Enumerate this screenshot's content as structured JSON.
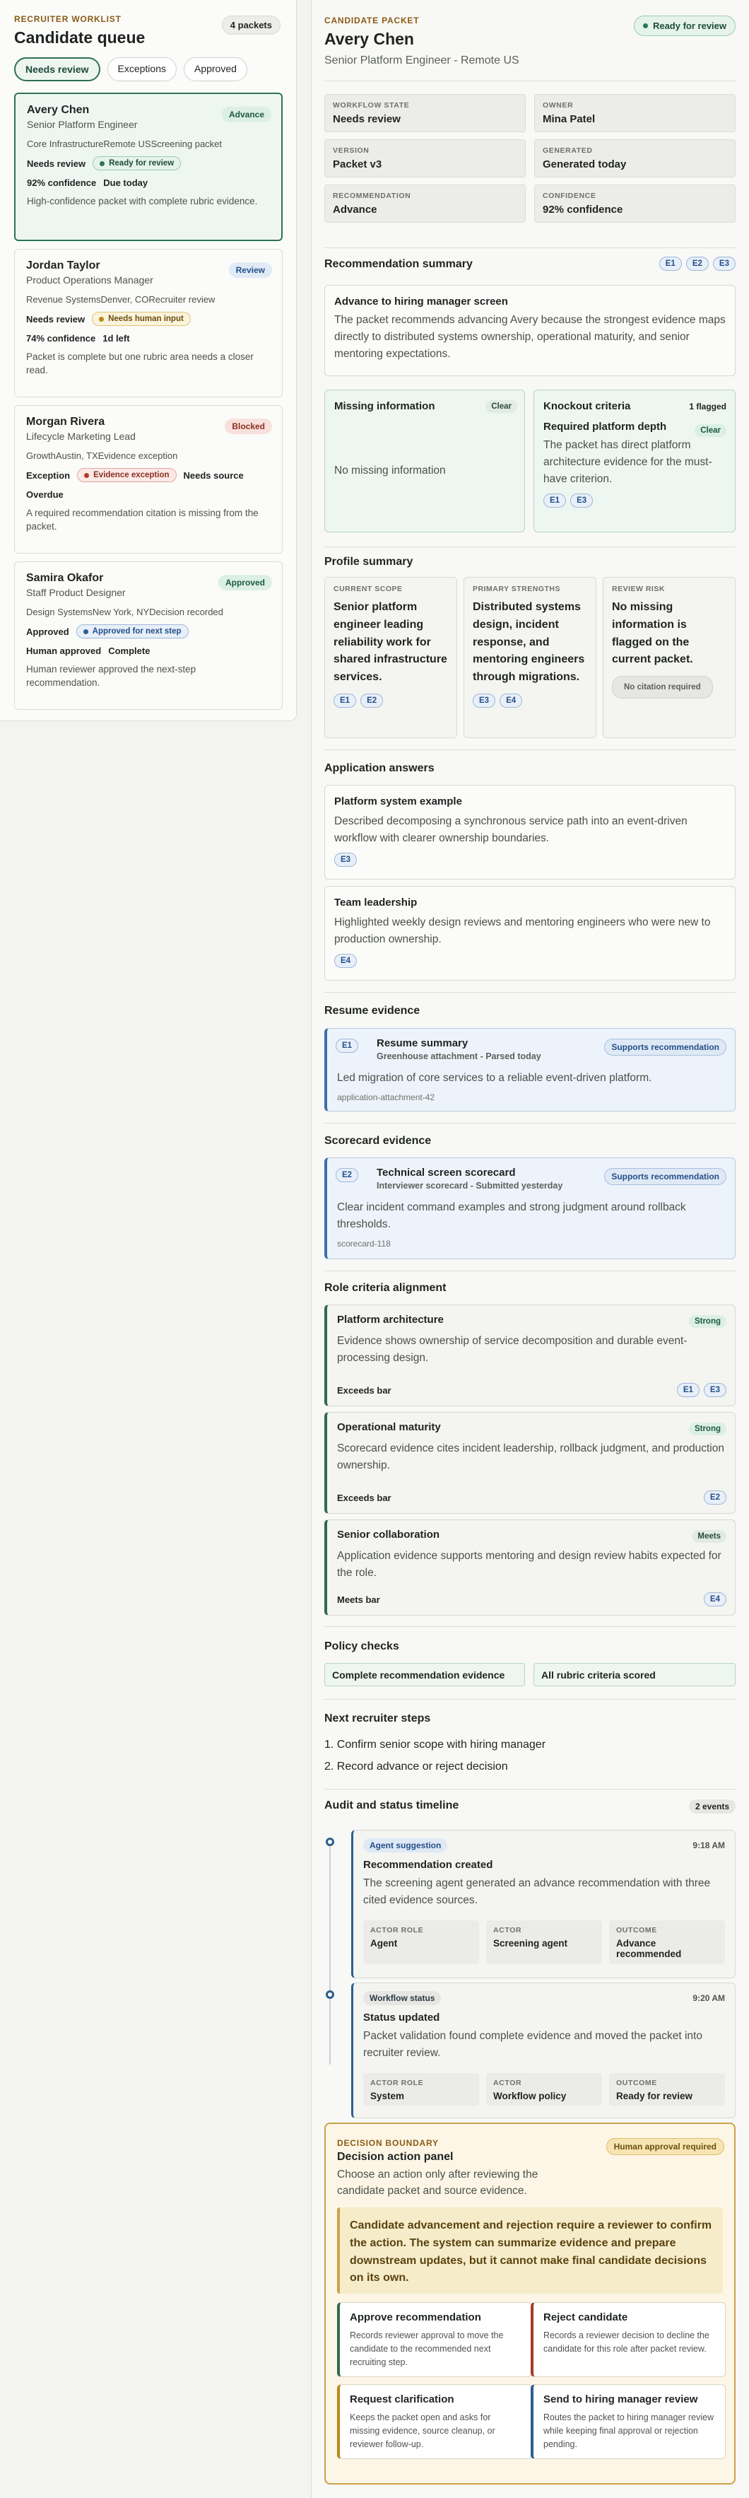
{
  "left": {
    "eyebrow": "RECRUITER WORKLIST",
    "title": "Candidate queue",
    "count": "4 packets",
    "tabs": [
      "Needs review",
      "Exceptions",
      "Approved"
    ],
    "cards": [
      {
        "name": "Avery Chen",
        "role": "Senior Platform Engineer",
        "badge": "Advance",
        "meta": "Core InfrastructureRemote USScreening packet",
        "state": "Needs review",
        "pill": "Ready for review",
        "confidence": "92% confidence",
        "due": "Due today",
        "note": "High-confidence packet with complete rubric evidence."
      },
      {
        "name": "Jordan Taylor",
        "role": "Product Operations Manager",
        "badge": "Review",
        "meta": "Revenue SystemsDenver, CORecruiter review",
        "state": "Needs review",
        "pill": "Needs human input",
        "confidence": "74% confidence",
        "due": "1d left",
        "note": "Packet is complete but one rubric area needs a closer read."
      },
      {
        "name": "Morgan Rivera",
        "role": "Lifecycle Marketing Lead",
        "badge": "Blocked",
        "meta": "GrowthAustin, TXEvidence exception",
        "state": "Exception",
        "pill": "Evidence exception",
        "confidence": "Needs source",
        "due": "Overdue",
        "note": "A required recommendation citation is missing from the packet."
      },
      {
        "name": "Samira Okafor",
        "role": "Staff Product Designer",
        "badge": "Approved",
        "meta": "Design SystemsNew York, NYDecision recorded",
        "state": "Approved",
        "pill": "Approved for next step",
        "confidence": "Human approved",
        "due": "Complete",
        "note": "Human reviewer approved the next-step recommendation."
      }
    ]
  },
  "header": {
    "eyebrow": "CANDIDATE PACKET",
    "name": "Avery Chen",
    "subtitle": "Senior Platform Engineer - Remote US",
    "status": "Ready for review"
  },
  "meta": [
    {
      "label": "WORKFLOW STATE",
      "value": "Needs review"
    },
    {
      "label": "OWNER",
      "value": "Mina Patel"
    },
    {
      "label": "VERSION",
      "value": "Packet v3"
    },
    {
      "label": "GENERATED",
      "value": "Generated today"
    },
    {
      "label": "RECOMMENDATION",
      "value": "Advance"
    },
    {
      "label": "CONFIDENCE",
      "value": "92% confidence"
    }
  ],
  "summary": {
    "title": "Recommendation summary",
    "badges": [
      "E1",
      "E2",
      "E3"
    ],
    "headline": "Advance to hiring manager screen",
    "text": "The packet recommends advancing Avery because the strongest evidence maps directly to distributed systems ownership, operational maturity, and senior mentoring expectations.",
    "missing_title": "Missing information",
    "missing_badge": "Clear",
    "missing_text": "No missing information",
    "knockout_title": "Knockout criteria",
    "knockout_badge": "1 flagged",
    "knockout_sub": "Required platform depth",
    "knockout_sub_badge": "Clear",
    "knockout_text": "The packet has direct platform architecture evidence for the must-have criterion.",
    "knockout_refs": [
      "E1",
      "E3"
    ]
  },
  "profile": {
    "title": "Profile summary",
    "cols": [
      {
        "label": "CURRENT SCOPE",
        "value": "Senior platform engineer leading reliability work for shared infrastructure services.",
        "refs": [
          "E1",
          "E2"
        ]
      },
      {
        "label": "PRIMARY STRENGTHS",
        "value": "Distributed systems design, incident response, and mentoring engineers through migrations.",
        "refs": [
          "E3",
          "E4"
        ]
      },
      {
        "label": "REVIEW RISK",
        "value": "No missing information is flagged on the current packet.",
        "note": "No citation required"
      }
    ]
  },
  "answers": {
    "title": "Application answers",
    "items": [
      {
        "title": "Platform system example",
        "text": "Described decomposing a synchronous service path into an event-driven workflow with clearer ownership boundaries.",
        "ref": "E3"
      },
      {
        "title": "Team leadership",
        "text": "Highlighted weekly design reviews and mentoring engineers who were new to production ownership.",
        "ref": "E4"
      }
    ]
  },
  "resume": {
    "title": "Resume evidence",
    "id": "E1",
    "name": "Resume summary",
    "source": "Greenhouse attachment - Parsed today",
    "badge": "Supports recommendation",
    "text": "Led migration of core services to a reliable event-driven platform.",
    "ref": "application-attachment-42"
  },
  "scorecard": {
    "title": "Scorecard evidence",
    "id": "E2",
    "name": "Technical screen scorecard",
    "source": "Interviewer scorecard - Submitted yesterday",
    "badge": "Supports recommendation",
    "text": "Clear incident command examples and strong judgment around rollback thresholds.",
    "ref": "scorecard-118"
  },
  "criteria": {
    "title": "Role criteria alignment",
    "items": [
      {
        "title": "Platform architecture",
        "badge": "Strong",
        "text": "Evidence shows ownership of service decomposition and durable event-processing design.",
        "bar": "Exceeds bar",
        "refs": [
          "E1",
          "E3"
        ]
      },
      {
        "title": "Operational maturity",
        "badge": "Strong",
        "text": "Scorecard evidence cites incident leadership, rollback judgment, and production ownership.",
        "bar": "Exceeds bar",
        "refs": [
          "E2"
        ]
      },
      {
        "title": "Senior collaboration",
        "badge": "Meets",
        "text": "Application evidence supports mentoring and design review habits expected for the role.",
        "bar": "Meets bar",
        "refs": [
          "E4"
        ]
      }
    ]
  },
  "policy": {
    "title": "Policy checks",
    "items": [
      "Complete recommendation evidence",
      "All rubric criteria scored"
    ]
  },
  "steps": {
    "title": "Next recruiter steps",
    "items": [
      "1. Confirm senior scope with hiring manager",
      "2. Record advance or reject decision"
    ]
  },
  "timeline": {
    "title": "Audit and status timeline",
    "count": "2 events",
    "events": [
      {
        "tag": "Agent suggestion",
        "time": "9:18 AM",
        "title": "Recommendation created",
        "text": "The screening agent generated an advance recommendation with three cited evidence sources.",
        "cells": [
          {
            "label": "ACTOR ROLE",
            "value": "Agent"
          },
          {
            "label": "ACTOR",
            "value": "Screening agent"
          },
          {
            "label": "OUTCOME",
            "value": "Advance recommended"
          }
        ]
      },
      {
        "tag": "Workflow status",
        "time": "9:20 AM",
        "title": "Status updated",
        "text": "Packet validation found complete evidence and moved the packet into recruiter review.",
        "cells": [
          {
            "label": "ACTOR ROLE",
            "value": "System"
          },
          {
            "label": "ACTOR",
            "value": "Workflow policy"
          },
          {
            "label": "OUTCOME",
            "value": "Ready for review"
          }
        ]
      }
    ]
  },
  "decision": {
    "eyebrow": "DECISION BOUNDARY",
    "title": "Decision action panel",
    "badge": "Human approval required",
    "sub": "Choose an action only after reviewing the candidate packet and source evidence.",
    "warning": "Candidate advancement and rejection require a reviewer to confirm the action. The system can summarize evidence and prepare downstream updates, but it cannot make final candidate decisions on its own.",
    "actions": [
      {
        "title": "Approve recommendation",
        "text": "Records reviewer approval to move the candidate to the recommended next recruiting step."
      },
      {
        "title": "Reject candidate",
        "text": "Records a reviewer decision to decline the candidate for this role after packet review."
      },
      {
        "title": "Request clarification",
        "text": "Keeps the packet open and asks for missing evidence, source cleanup, or reviewer follow-up."
      },
      {
        "title": "Send to hiring manager review",
        "text": "Routes the packet to hiring manager review while keeping final approval or rejection pending."
      }
    ]
  }
}
